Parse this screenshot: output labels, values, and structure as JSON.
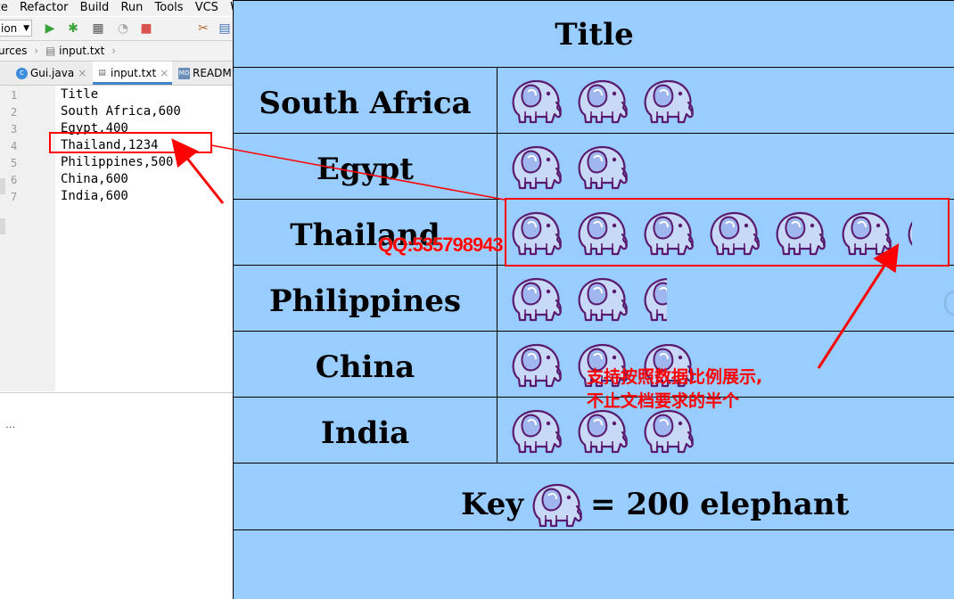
{
  "ide": {
    "menu": [
      "ze",
      "Refactor",
      "Build",
      "Run",
      "Tools",
      "VCS",
      "Wi"
    ],
    "run_config": "ion",
    "breadcrumb": [
      "urces",
      "input.txt"
    ],
    "tabs": [
      {
        "label": "Gui.java",
        "icon": "java-class-icon"
      },
      {
        "label": "input.txt",
        "icon": "text-file-icon"
      },
      {
        "label": "READM",
        "icon": "markdown-file-icon"
      }
    ],
    "line_numbers": [
      "1",
      "2",
      "3",
      "4",
      "5",
      "6",
      "7"
    ],
    "lines": [
      "Title",
      "South Africa,600",
      "Egypt,400",
      "Thailand,1234",
      "Philippines,500",
      "China,600",
      "India,600"
    ],
    "lower_text": "..."
  },
  "chart_data": {
    "type": "pictograph",
    "title": "Title",
    "categories": [
      "South Africa",
      "Egypt",
      "Thailand",
      "Philippines",
      "China",
      "India"
    ],
    "values": [
      600,
      400,
      1234,
      500,
      600,
      600
    ],
    "unit_value": 200,
    "icon": "elephant-icon",
    "key_prefix": "Key",
    "key_suffix": "= 200 elephant"
  },
  "annotations": {
    "watermark": "QQ:535798943",
    "note_line1": "支持按照数据比例展示,",
    "note_line2": "不止文档要求的半个",
    "color": "#ff0000"
  },
  "colors": {
    "panel_bg": "#99ccff",
    "elephant_fill": "#c7d9f7",
    "elephant_stroke": "#5a1a6e"
  }
}
